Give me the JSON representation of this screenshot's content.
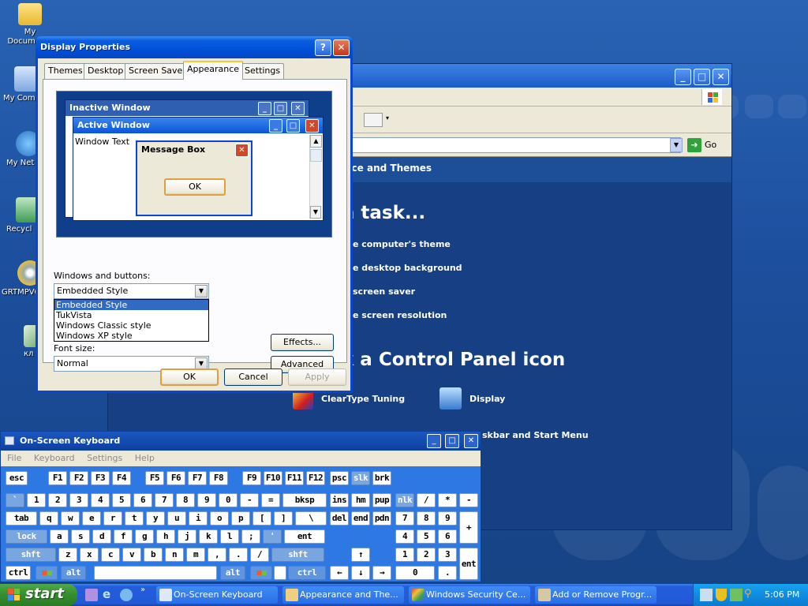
{
  "desktop": {
    "icons": [
      {
        "label": "My Documents"
      },
      {
        "label": "My Comp"
      },
      {
        "label": "My Net Plac"
      },
      {
        "label": "Recycl"
      },
      {
        "label": "GRTMPVO"
      },
      {
        "label": "кл"
      }
    ]
  },
  "control_panel": {
    "go_label": "Go",
    "crumb": "nce and Themes",
    "heading_task": "n task...",
    "tasks": [
      "e computer's theme",
      "e desktop background",
      "screen saver",
      "e screen resolution"
    ],
    "heading_icon": "k a Control Panel icon",
    "icons": [
      {
        "label": "ClearType Tuning",
        "icon": "cleartype-icon"
      },
      {
        "label": "Display",
        "icon": "display-icon"
      },
      {
        "label": "skbar and Start Menu",
        "icon": "taskbar-icon"
      }
    ]
  },
  "display_properties": {
    "title": "Display Properties",
    "tabs": [
      "Themes",
      "Desktop",
      "Screen Saver",
      "Appearance",
      "Settings"
    ],
    "active_tab": "Appearance",
    "preview": {
      "inactive_title": "Inactive Window",
      "active_title": "Active Window",
      "window_text": "Window Text",
      "message_title": "Message Box",
      "ok_label": "OK"
    },
    "windows_buttons_label": "Windows and buttons:",
    "windows_buttons_value": "Embedded Style",
    "windows_buttons_options": [
      "Embedded Style",
      "TukVista",
      "Windows Classic style",
      "Windows XP style"
    ],
    "font_size_label": "Font size:",
    "font_size_value": "Normal",
    "effects_label": "Effects...",
    "advanced_label": "Advanced",
    "ok_label": "OK",
    "cancel_label": "Cancel",
    "apply_label": "Apply"
  },
  "osk": {
    "title": "On-Screen Keyboard",
    "menu": [
      "File",
      "Keyboard",
      "Settings",
      "Help"
    ],
    "rows": {
      "r1": [
        "esc",
        "F1",
        "F2",
        "F3",
        "F4",
        "F5",
        "F6",
        "F7",
        "F8",
        "F9",
        "F10",
        "F11",
        "F12",
        "psc",
        "slk",
        "brk"
      ],
      "r2": [
        "`",
        "1",
        "2",
        "3",
        "4",
        "5",
        "6",
        "7",
        "8",
        "9",
        "0",
        "-",
        "=",
        "bksp",
        "ins",
        "hm",
        "pup",
        "nlk",
        "/",
        "*",
        "-"
      ],
      "r3": [
        "tab",
        "q",
        "w",
        "e",
        "r",
        "t",
        "y",
        "u",
        "i",
        "o",
        "p",
        "[",
        "]",
        "\\",
        "del",
        "end",
        "pdn",
        "7",
        "8",
        "9",
        "+"
      ],
      "r4": [
        "lock",
        "a",
        "s",
        "d",
        "f",
        "g",
        "h",
        "j",
        "k",
        "l",
        ";",
        "'",
        "ent",
        "4",
        "5",
        "6"
      ],
      "r5": [
        "shft",
        "z",
        "x",
        "c",
        "v",
        "b",
        "n",
        "m",
        ",",
        ".",
        "/",
        "shft",
        "↑",
        "1",
        "2",
        "3",
        "ent"
      ],
      "r6": [
        "ctrl",
        "alt",
        "alt",
        "ctrl",
        "←",
        "↓",
        "→",
        "0",
        "."
      ]
    }
  },
  "taskbar": {
    "start_label": "start",
    "tasks": [
      {
        "label": "On-Screen Keyboard"
      },
      {
        "label": "Appearance and The..."
      },
      {
        "label": "Windows Security Ce..."
      },
      {
        "label": "Add or Remove Progr..."
      }
    ],
    "clock": "5:06 PM"
  }
}
